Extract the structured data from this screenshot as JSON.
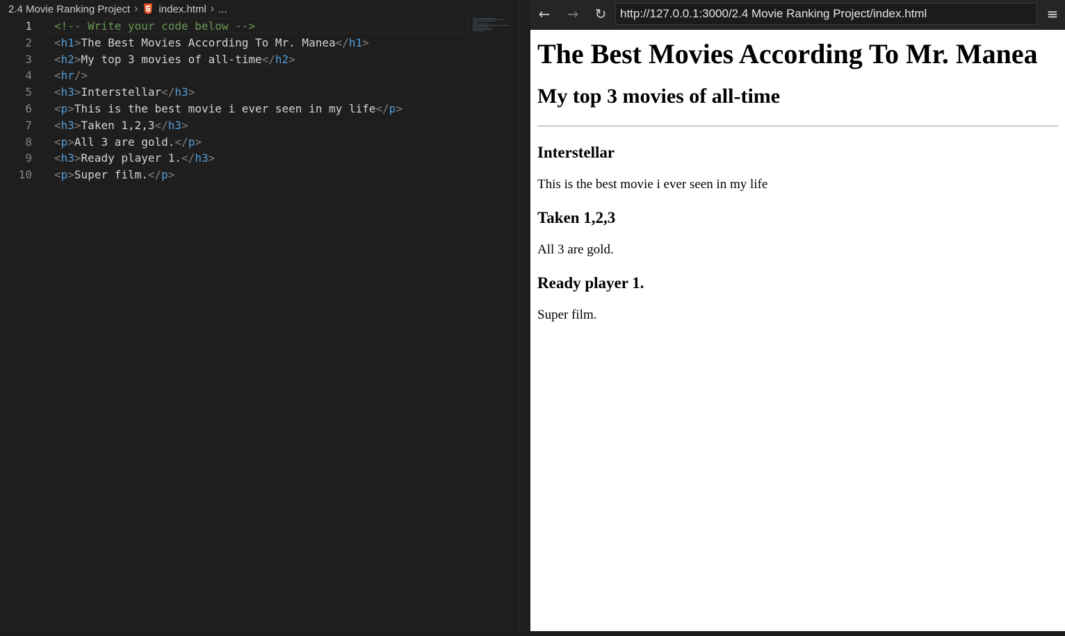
{
  "editor": {
    "breadcrumb": {
      "folder": "2.4 Movie Ranking Project",
      "file": "index.html",
      "more": "..."
    },
    "lines": [
      {
        "n": "1",
        "tokens": [
          [
            "comment",
            "<!-- Write your code below -->"
          ]
        ]
      },
      {
        "n": "2",
        "tokens": [
          [
            "bracket",
            "<"
          ],
          [
            "tag",
            "h1"
          ],
          [
            "bracket",
            ">"
          ],
          [
            "text",
            "The Best Movies According To Mr. Manea"
          ],
          [
            "bracket",
            "</"
          ],
          [
            "tag",
            "h1"
          ],
          [
            "bracket",
            ">"
          ]
        ]
      },
      {
        "n": "3",
        "tokens": [
          [
            "bracket",
            "<"
          ],
          [
            "tag",
            "h2"
          ],
          [
            "bracket",
            ">"
          ],
          [
            "text",
            "My top 3 movies of all-time"
          ],
          [
            "bracket",
            "</"
          ],
          [
            "tag",
            "h2"
          ],
          [
            "bracket",
            ">"
          ]
        ]
      },
      {
        "n": "4",
        "tokens": [
          [
            "bracket",
            "<"
          ],
          [
            "tag",
            "hr"
          ],
          [
            "bracket",
            "/>"
          ]
        ]
      },
      {
        "n": "5",
        "tokens": [
          [
            "bracket",
            "<"
          ],
          [
            "tag",
            "h3"
          ],
          [
            "bracket",
            ">"
          ],
          [
            "text",
            "Interstellar"
          ],
          [
            "bracket",
            "</"
          ],
          [
            "tag",
            "h3"
          ],
          [
            "bracket",
            ">"
          ]
        ]
      },
      {
        "n": "6",
        "tokens": [
          [
            "bracket",
            "<"
          ],
          [
            "tag",
            "p"
          ],
          [
            "bracket",
            ">"
          ],
          [
            "text",
            "This is the best movie i ever seen in my life"
          ],
          [
            "bracket",
            "</"
          ],
          [
            "tag",
            "p"
          ],
          [
            "bracket",
            ">"
          ]
        ]
      },
      {
        "n": "7",
        "tokens": [
          [
            "bracket",
            "<"
          ],
          [
            "tag",
            "h3"
          ],
          [
            "bracket",
            ">"
          ],
          [
            "text",
            "Taken 1,2,3"
          ],
          [
            "bracket",
            "</"
          ],
          [
            "tag",
            "h3"
          ],
          [
            "bracket",
            ">"
          ]
        ]
      },
      {
        "n": "8",
        "tokens": [
          [
            "bracket",
            "<"
          ],
          [
            "tag",
            "p"
          ],
          [
            "bracket",
            ">"
          ],
          [
            "text",
            "All 3 are gold."
          ],
          [
            "bracket",
            "</"
          ],
          [
            "tag",
            "p"
          ],
          [
            "bracket",
            ">"
          ]
        ]
      },
      {
        "n": "9",
        "tokens": [
          [
            "bracket",
            "<"
          ],
          [
            "tag",
            "h3"
          ],
          [
            "bracket",
            ">"
          ],
          [
            "text",
            "Ready player 1."
          ],
          [
            "bracket",
            "</"
          ],
          [
            "tag",
            "h3"
          ],
          [
            "bracket",
            ">"
          ]
        ]
      },
      {
        "n": "10",
        "tokens": [
          [
            "bracket",
            "<"
          ],
          [
            "tag",
            "p"
          ],
          [
            "bracket",
            ">"
          ],
          [
            "text",
            "Super film."
          ],
          [
            "bracket",
            "</"
          ],
          [
            "tag",
            "p"
          ],
          [
            "bracket",
            ">"
          ]
        ]
      }
    ],
    "current_line": "1"
  },
  "browser": {
    "back_icon": "←",
    "forward_icon": "→",
    "reload_icon": "↻",
    "menu_icon": "≡",
    "url": "http://127.0.0.1:3000/2.4 Movie Ranking Project/index.html",
    "page": {
      "h1": "The Best Movies According To Mr. Manea",
      "h2": "My top 3 movies of all-time",
      "movies": [
        {
          "title": "Interstellar",
          "desc": "This is the best movie i ever seen in my life"
        },
        {
          "title": "Taken 1,2,3",
          "desc": "All 3 are gold."
        },
        {
          "title": "Ready player 1.",
          "desc": "Super film."
        }
      ]
    }
  },
  "colors": {
    "comment": "#6a9955",
    "tag": "#569cd6",
    "bracket": "#808080",
    "text": "#d4d4d4",
    "html5": "#e44d26"
  }
}
